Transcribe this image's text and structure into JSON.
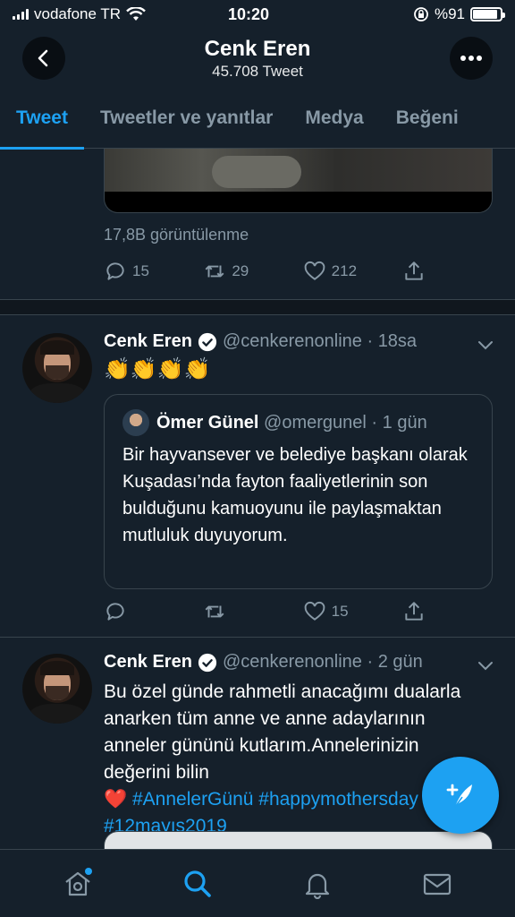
{
  "status_bar": {
    "carrier": "vodafone TR",
    "time": "10:20",
    "battery": "%91",
    "battery_level": 0.91
  },
  "header": {
    "name": "Cenk Eren",
    "tweet_count": "45.708 Tweet"
  },
  "tabs": [
    {
      "label": "Tweet",
      "active": true
    },
    {
      "label": "Tweetler ve yanıtlar",
      "active": false
    },
    {
      "label": "Medya",
      "active": false
    },
    {
      "label": "Beğeni",
      "active": false
    }
  ],
  "tweets": [
    {
      "views": "17,8B görüntülenme",
      "reply_count": "15",
      "retweet_count": "29",
      "like_count": "212"
    },
    {
      "name": "Cenk Eren",
      "handle": "@cenkerenonline",
      "time": "18sa",
      "text": "👏👏👏👏",
      "quoted": {
        "name": "Ömer Günel",
        "handle": "@omergunel",
        "time": "1 gün",
        "text": "Bir hayvansever ve belediye başkanı olarak Kuşadası’nda fayton faaliyetlerinin son bulduğunu kamuoyunu ile paylaşmaktan mutluluk duyuyorum."
      },
      "reply_count": "",
      "retweet_count": "",
      "like_count": "15"
    },
    {
      "name": "Cenk Eren",
      "handle": "@cenkerenonline",
      "time": "2 gün",
      "text": "Bu özel günde rahmetli anacağımı dualarla anarken tüm anne ve anne adaylarının anneler gününü kutlarım.Annelerinizin değerini bilin",
      "emoji": "❤️",
      "hashtags_line1": "#AnnelerGünü #happymothersday",
      "hashtags_line2": "#12mayıs2019"
    }
  ],
  "colors": {
    "background": "#15202b",
    "accent": "#1da1f2",
    "secondary_text": "#8899a6",
    "border": "#38444d"
  },
  "icons": {
    "back": "chevron-left-icon",
    "more": "ellipsis-icon",
    "reply": "reply-icon",
    "retweet": "retweet-icon",
    "like": "heart-icon",
    "share": "share-icon",
    "compose": "compose-feather-icon",
    "home": "home-icon",
    "search": "search-icon",
    "notifications": "bell-icon",
    "messages": "mail-icon"
  }
}
